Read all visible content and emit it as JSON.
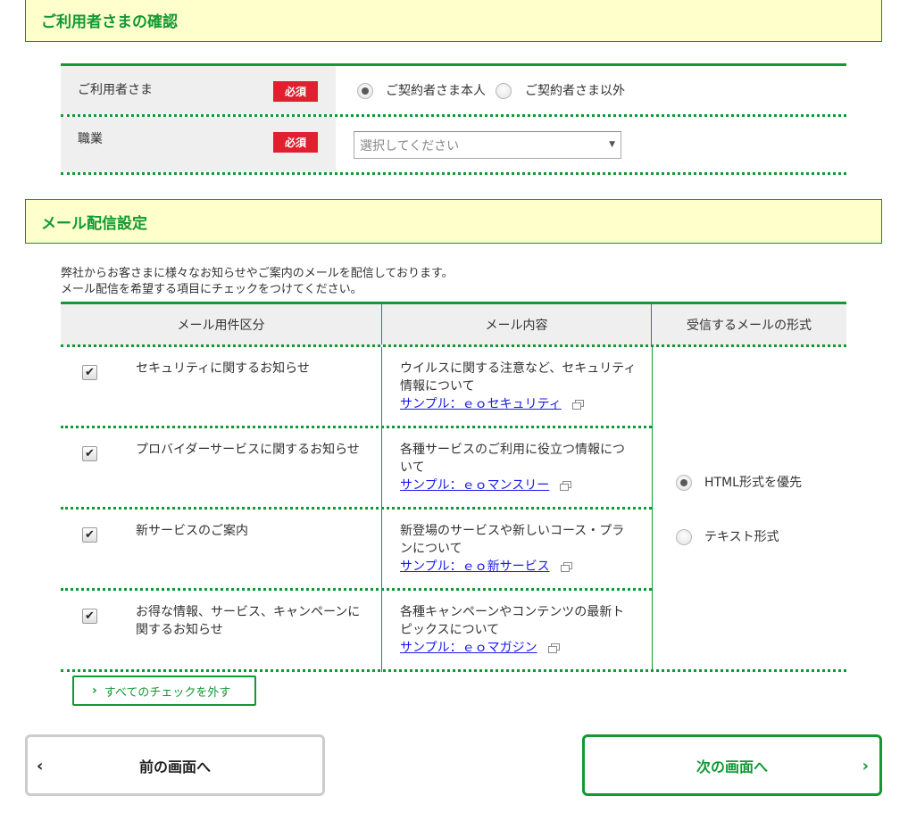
{
  "user_section": {
    "header": "ご利用者さまの確認",
    "required_badge": "必須",
    "user_row": {
      "label": "ご利用者さま",
      "options": [
        "ご契約者さま本人",
        "ご契約者さま以外"
      ],
      "selected": "ご契約者さま本人"
    },
    "occupation_row": {
      "label": "職業",
      "select_placeholder": "選択してください",
      "select_arrow": "▼"
    }
  },
  "mail_section": {
    "header": "メール配信設定",
    "intro_lines": [
      "弊社からお客さまに様々なお知らせやご案内のメールを配信しております。",
      "メール配信を希望する項目にチェックをつけてください。"
    ],
    "columns": [
      "メール用件区分",
      "メール内容",
      "受信するメールの形式"
    ],
    "rows": [
      {
        "checked": true,
        "title": "セキュリティに関するお知らせ",
        "description": "ウイルスに関する注意など、セキュリティ情報について",
        "link": "サンプル：ｅｏセキュリティ"
      },
      {
        "checked": true,
        "title": "プロバイダーサービスに関するお知らせ",
        "description": "各種サービスのご利用に役立つ情報について",
        "link": "サンプル：ｅｏマンスリー"
      },
      {
        "checked": true,
        "title": "新サービスのご案内",
        "description": "新登場のサービスや新しいコース・プランについて",
        "link": "サンプル：ｅｏ新サービス"
      },
      {
        "checked": true,
        "title": "お得な情報、サービス、キャンペーンに関するお知らせ",
        "description": "各種キャンペーンやコンテンツの最新トピックスについて",
        "link": "サンプル：ｅｏマガジン"
      }
    ],
    "format_options": [
      "HTML形式を優先",
      "テキスト形式"
    ],
    "format_selected": "HTML形式を優先",
    "uncheck_all_label": "すべてのチェックを外す"
  },
  "navigation": {
    "prev_label": "前の画面へ",
    "next_label": "次の画面へ"
  },
  "colors": {
    "accent_green": "#119933",
    "header_bg": "#ffffcc",
    "badge_red": "#e0202f",
    "link_blue": "#1a1aee"
  },
  "check_mark": "✔"
}
